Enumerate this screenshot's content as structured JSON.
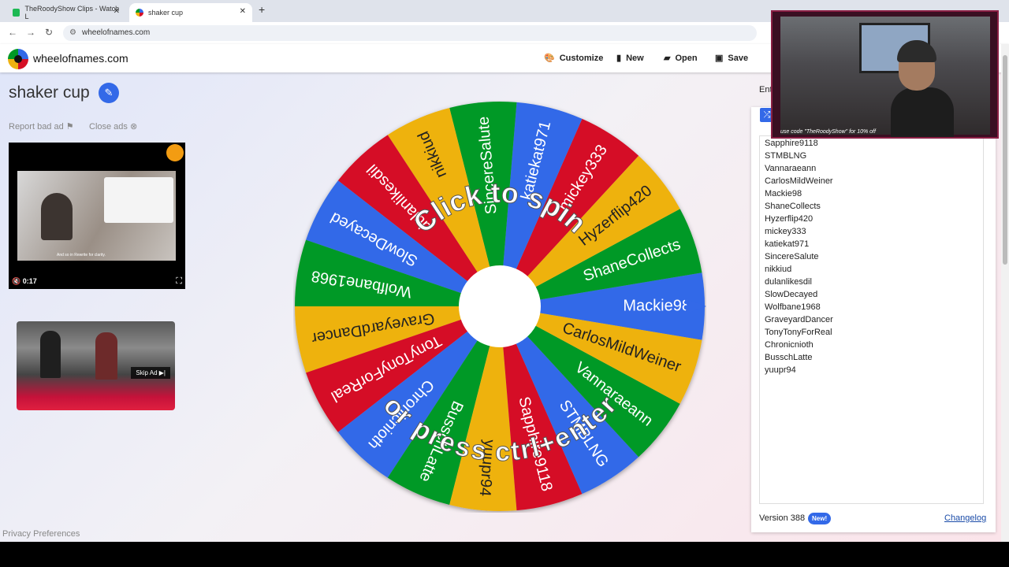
{
  "browser": {
    "tabs": [
      {
        "label": "TheRoodyShow Clips - Watch L",
        "active": false,
        "favicon_color": "#1db954"
      },
      {
        "label": "shaker cup",
        "active": true,
        "favicon_color": "#4285f4"
      }
    ],
    "url": "wheelofnames.com"
  },
  "site": {
    "name": "wheelofnames.com",
    "buttons": {
      "customize": "Customize",
      "new": "New",
      "open": "Open",
      "save": "Save"
    },
    "wheel_title": "shaker cup",
    "report_ad": "Report bad ad",
    "close_ads": "Close ads",
    "ad_time": "0:17",
    "ad_subtitle": "And so in Rewrite for clarity.",
    "skip_ad": "Skip Ad",
    "privacy": "Privacy Preferences"
  },
  "wheel": {
    "prompt_line1": "Click to spin",
    "prompt_line2": "or press ctrl+enter",
    "segment_colors": [
      "#d50f25",
      "#3369e8",
      "#009925",
      "#eeb211"
    ],
    "segments": [
      "Mackie98",
      "ShaneCollects",
      "Hyzerflip420",
      "mickey333",
      "katiekat971",
      "SincereSalute",
      "nikkiud",
      "dulanlikesdil",
      "SlowDecayed",
      "Wolfbane1968",
      "GraveyardDancer",
      "TonyTonyForReal",
      "Chronicnioth",
      "BusschLatte",
      "yuupr94",
      "Sapphire9118",
      "STMBLNG",
      "Vannaraeann",
      "CarlosMildWeiner"
    ]
  },
  "entries_panel": {
    "tab_label": "Ent",
    "entries": [
      "Sapphire9118",
      "STMBLNG",
      "Vannaraeann",
      "CarlosMildWeiner",
      "Mackie98",
      "ShaneCollects",
      "Hyzerflip420",
      "mickey333",
      "katiekat971",
      "SincereSalute",
      "nikkiud",
      "dulanlikesdil",
      "SlowDecayed",
      "Wolfbane1968",
      "GraveyardDancer",
      "TonyTonyForReal",
      "Chronicnioth",
      "BusschLatte",
      "yuupr94"
    ],
    "version": "Version 388",
    "new_badge": "New!",
    "changelog": "Changelog"
  },
  "webcam": {
    "promo": "use code \"TheRoodyShow\" for 10% off"
  }
}
